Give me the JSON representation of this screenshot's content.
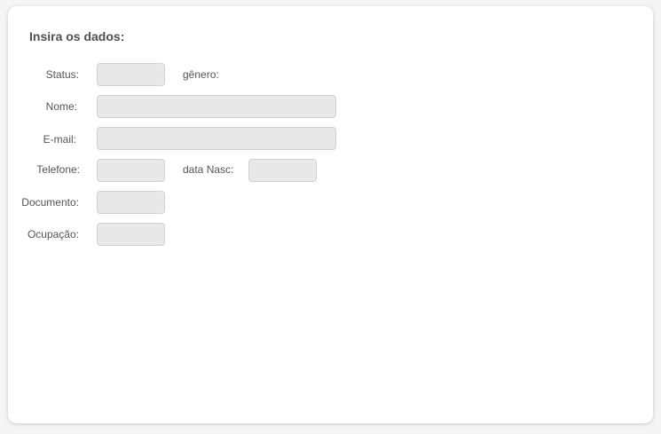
{
  "form": {
    "title": "Insira os dados:",
    "status_label": "Status:",
    "status_value": "",
    "genero_label": "gênero:",
    "nome_label": "Nome:",
    "nome_value": "",
    "email_label": "E-mail:",
    "email_value": "",
    "telefone_label": "Telefone:",
    "telefone_value": "",
    "data_nasc_label": "data Nasc:",
    "data_nasc_value": "",
    "documento_label": "Documento:",
    "documento_value": "",
    "ocupacao_label": "Ocupação:",
    "ocupacao_value": ""
  }
}
